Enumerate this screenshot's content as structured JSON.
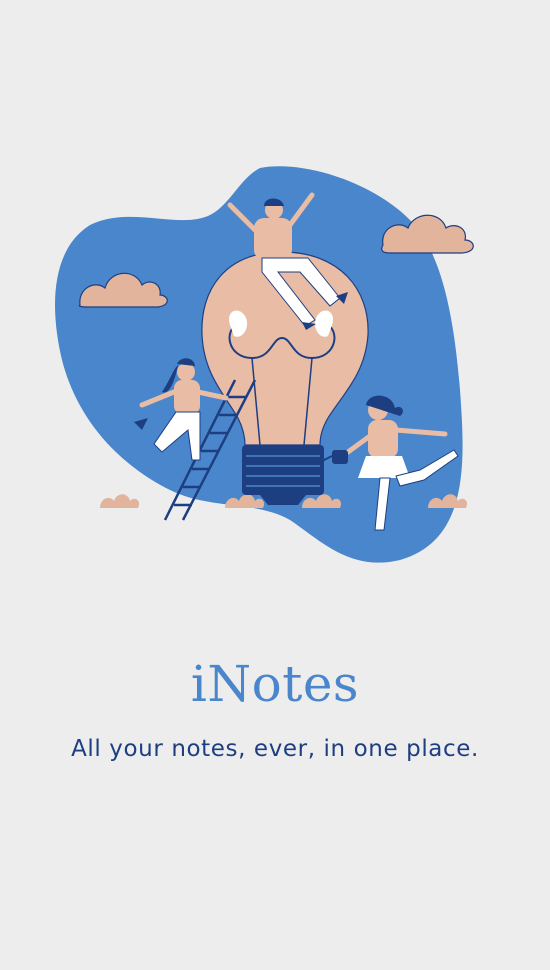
{
  "app": {
    "title": "iNotes",
    "tagline": "All your notes, ever, in one place."
  },
  "illustration": {
    "subject": "lightbulb-with-people",
    "colors": {
      "background": "#ededee",
      "blob": "#4a86cb",
      "bulb": "#e8bca5",
      "clouds": "#e2b49c",
      "navy": "#1e3e82",
      "white": "#ffffff"
    }
  },
  "colors": {
    "title": "#4a86cb",
    "tagline": "#1e3e82"
  }
}
